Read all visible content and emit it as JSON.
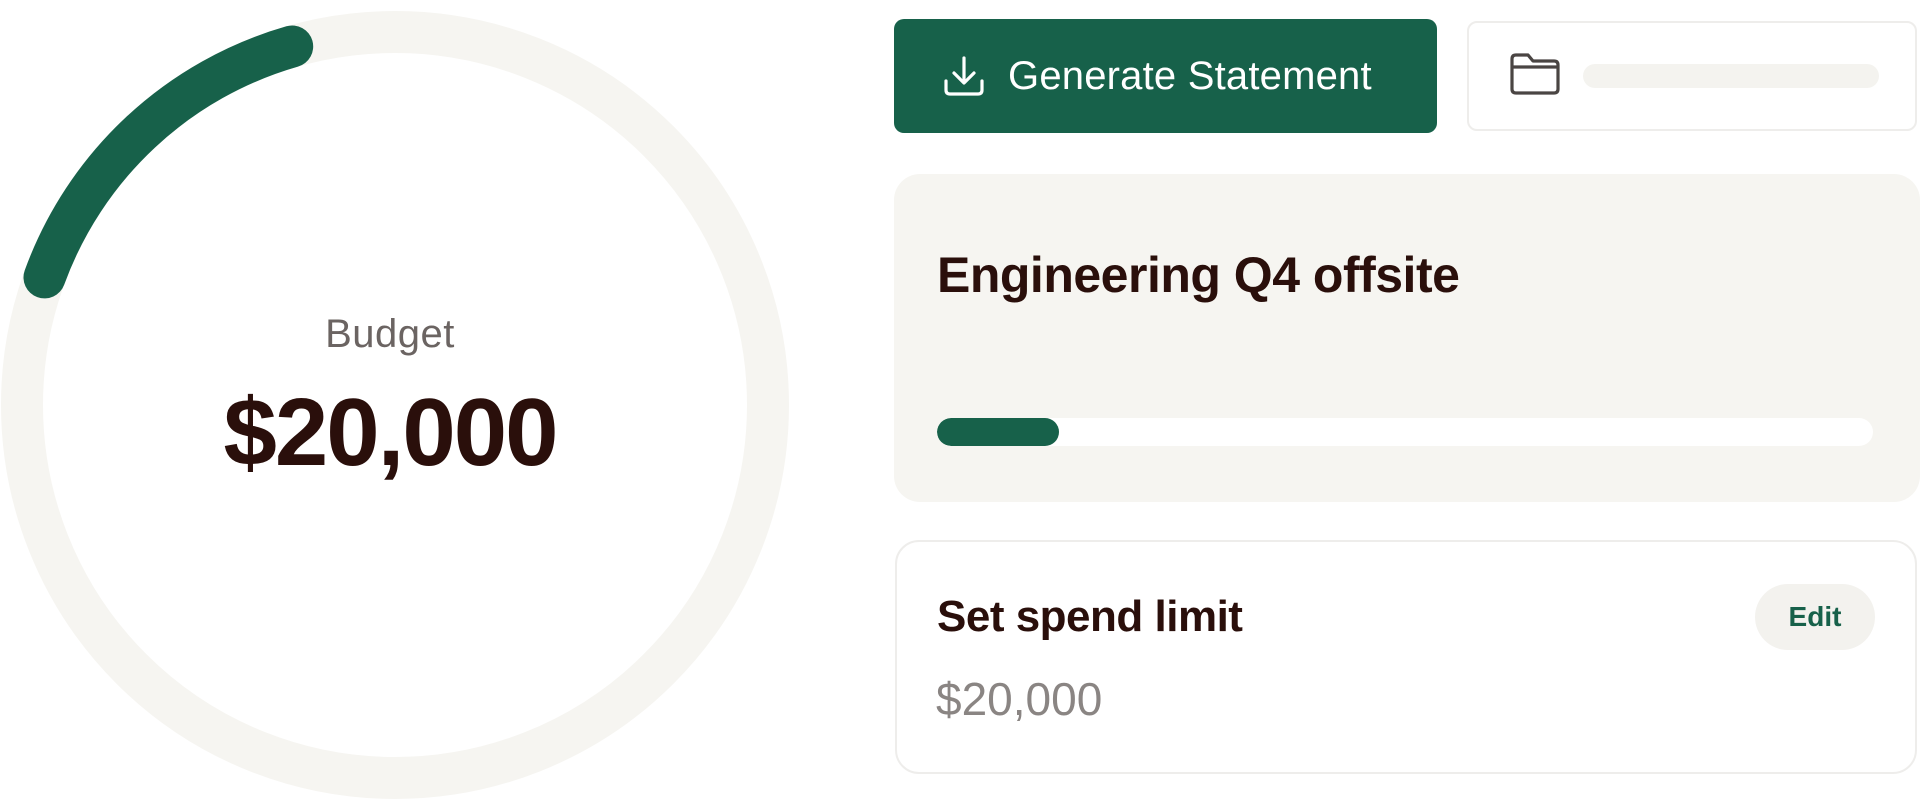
{
  "budget": {
    "label": "Budget",
    "amount": "$20,000",
    "spent_fraction": 0.15
  },
  "actions": {
    "generate_statement_label": "Generate Statement",
    "generate_icon": "download-icon",
    "folder_icon": "folder-icon"
  },
  "project": {
    "title": "Engineering Q4 offsite",
    "progress_fraction": 0.13
  },
  "spend_limit": {
    "title": "Set spend limit",
    "amount": "$20,000",
    "edit_label": "Edit"
  },
  "colors": {
    "accent": "#17614a",
    "track": "#f6f5f1",
    "text_dark": "#2a0f0b",
    "text_muted": "#8a8583"
  }
}
